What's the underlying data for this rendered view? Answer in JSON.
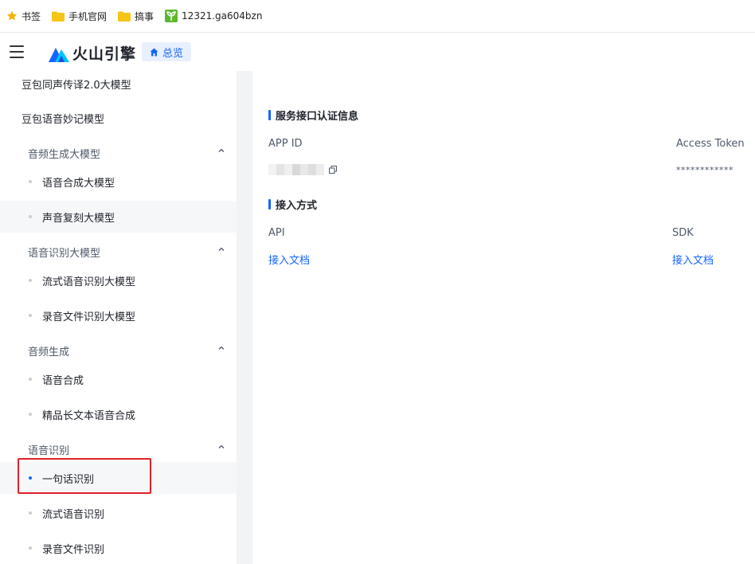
{
  "bookmarks": [
    {
      "label": "书签",
      "icon": "star-icon"
    },
    {
      "label": "手机官网",
      "icon": "folder-icon"
    },
    {
      "label": "搞事",
      "icon": "folder-icon"
    },
    {
      "label": "12321.ga604bzn",
      "icon": "sprout-icon"
    }
  ],
  "header": {
    "logo_text": "火山引擎",
    "overview_label": "总览"
  },
  "sidebar": {
    "items": [
      {
        "label": "豆包同声传译2.0大模型"
      },
      {
        "label": "豆包语音妙记模型"
      }
    ],
    "groups": [
      {
        "label": "音频生成大模型",
        "items": [
          {
            "label": "语音合成大模型"
          },
          {
            "label": "声音复刻大模型"
          }
        ]
      },
      {
        "label": "语音识别大模型",
        "items": [
          {
            "label": "流式语音识别大模型"
          },
          {
            "label": "录音文件识别大模型"
          }
        ]
      },
      {
        "label": "音频生成",
        "items": [
          {
            "label": "语音合成"
          },
          {
            "label": "精品长文本语音合成"
          }
        ]
      },
      {
        "label": "语音识别",
        "items": [
          {
            "label": "一句话识别"
          },
          {
            "label": "流式语音识别"
          },
          {
            "label": "录音文件识别"
          }
        ]
      }
    ]
  },
  "main": {
    "auth_title": "服务接口认证信息",
    "app_id_label": "APP ID",
    "access_token_label": "Access Token",
    "access_token_value": "************",
    "access_title": "接入方式",
    "api_label": "API",
    "sdk_label": "SDK",
    "api_doc_link": "接入文档",
    "sdk_doc_link": "接入文档"
  },
  "colors": {
    "accent": "#1664ff",
    "highlight_border": "#e0202a",
    "sidebar_active_bg": "#f6f7f9"
  }
}
